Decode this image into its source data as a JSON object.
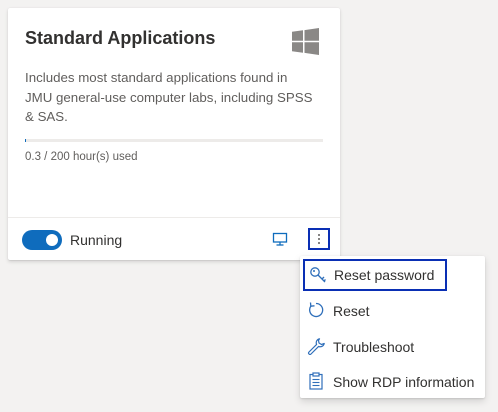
{
  "card": {
    "title": "Standard Applications",
    "os_icon": "windows-icon",
    "description": "Includes most standard applications found in JMU general-use computer labs, including SPSS & SAS.",
    "usage_text": "0.3 / 200 hour(s) used",
    "usage_fraction": 0.0015,
    "status_toggle_on": true,
    "status_text": "Running",
    "connect_icon": "monitor-icon",
    "more_icon": "more-vertical-icon"
  },
  "menu": {
    "items": [
      {
        "label": "Reset password",
        "icon": "key-icon"
      },
      {
        "label": "Reset",
        "icon": "refresh-icon"
      },
      {
        "label": "Troubleshoot",
        "icon": "wrench-icon"
      },
      {
        "label": "Show RDP information",
        "icon": "clipboard-icon"
      }
    ]
  },
  "colors": {
    "accent": "#0f6cbd",
    "focus_outline": "#0a2fb4",
    "icon_blue": "#2f6fba"
  }
}
